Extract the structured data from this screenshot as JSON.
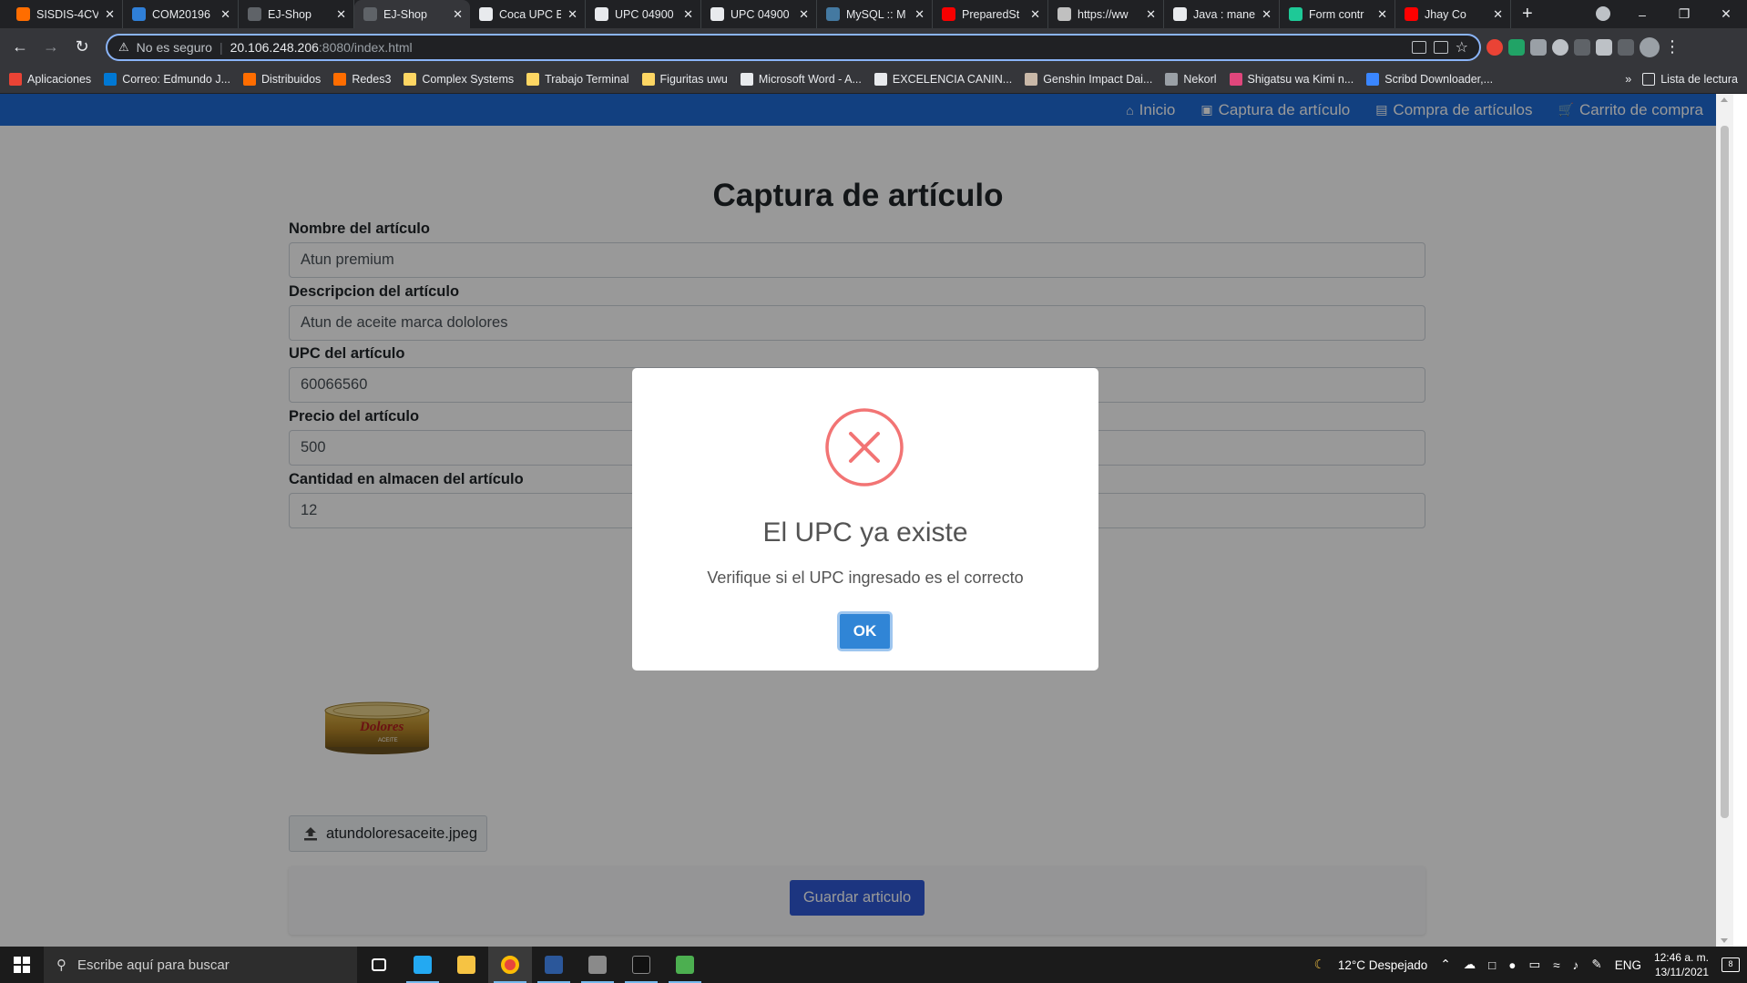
{
  "browser": {
    "tabs": [
      {
        "title": "SISDIS-4CV",
        "icon": "in-logo-icon",
        "color": "#ff6d00"
      },
      {
        "title": "COM20196",
        "icon": "azure-icon",
        "color": "#2f7fd8"
      },
      {
        "title": "EJ-Shop",
        "icon": "globe-icon",
        "color": "#5f6368"
      },
      {
        "title": "EJ-Shop",
        "icon": "globe-icon",
        "color": "#5f6368",
        "active": true
      },
      {
        "title": "Coca UPC B",
        "icon": "barcode-icon",
        "color": "#e8eaed"
      },
      {
        "title": "UPC 04900",
        "icon": "barcode-icon",
        "color": "#e8eaed"
      },
      {
        "title": "UPC 04900",
        "icon": "barcode-icon",
        "color": "#e8eaed"
      },
      {
        "title": "MySQL :: M",
        "icon": "mysql-icon",
        "color": "#4479a1"
      },
      {
        "title": "PreparedSt",
        "icon": "oracle-icon",
        "color": "#f80000"
      },
      {
        "title": "https://ww",
        "icon": "site-icon",
        "color": "#c0c0c0"
      },
      {
        "title": "Java : mane",
        "icon": "doc-icon",
        "color": "#e8eaed"
      },
      {
        "title": "Form contr",
        "icon": "leaf-icon",
        "color": "#1ec997"
      },
      {
        "title": "Jhay Co",
        "icon": "youtube-icon",
        "color": "#ff0000"
      }
    ],
    "security_label": "No es seguro",
    "url_host": "20.106.248.206",
    "url_rest": ":8080/index.html"
  },
  "bookmarks": [
    {
      "label": "Aplicaciones",
      "color": "#ea4335"
    },
    {
      "label": "Correo: Edmundo J...",
      "color": "#0078d4"
    },
    {
      "label": "Distribuidos",
      "color": "#ff6d00"
    },
    {
      "label": "Redes3",
      "color": "#ff6d00"
    },
    {
      "label": "Complex Systems",
      "color": "#fdd663"
    },
    {
      "label": "Trabajo Terminal",
      "color": "#fdd663"
    },
    {
      "label": "Figuritas uwu",
      "color": "#fdd663"
    },
    {
      "label": "Microsoft Word - A...",
      "color": "#e8eaed"
    },
    {
      "label": "EXCELENCIA CANIN...",
      "color": "#e8eaed"
    },
    {
      "label": "Genshin Impact Dai...",
      "color": "#c9b8a8"
    },
    {
      "label": "Nekorl",
      "color": "#9aa0a6"
    },
    {
      "label": "Shigatsu wa Kimi n...",
      "color": "#e0467c"
    },
    {
      "label": "Scribd Downloader,...",
      "color": "#3a86ff"
    }
  ],
  "bookmarks_more": "»",
  "reading_list": "Lista de lectura",
  "navbar": {
    "links": [
      {
        "label": "Inicio",
        "icon": "home-icon"
      },
      {
        "label": "Captura de artículo",
        "icon": "save-icon"
      },
      {
        "label": "Compra de artículos",
        "icon": "shopping-bag-icon"
      },
      {
        "label": "Carrito de compra",
        "icon": "cart-icon"
      }
    ]
  },
  "form": {
    "title": "Captura de artículo",
    "fields": [
      {
        "label": "Nombre del artículo",
        "value": "Atun premium"
      },
      {
        "label": "Descripcion del artículo",
        "value": "Atun de aceite marca dololores"
      },
      {
        "label": "UPC del artículo",
        "value": "60066560"
      },
      {
        "label": "Precio del artículo",
        "value": "500"
      },
      {
        "label": "Cantidad en almacen del artículo",
        "value": "12"
      }
    ],
    "image_brand": "Dolores",
    "image_caption": "ACEITE",
    "file_name": "atundoloresaceite.jpeg",
    "save_label": "Guardar articulo"
  },
  "modal": {
    "title": "El UPC ya existe",
    "text": "Verifique si el UPC ingresado es el correcto",
    "ok_label": "OK",
    "icon": "error-x-icon",
    "icon_color": "#f27474",
    "button_color": "#3085d6"
  },
  "taskbar": {
    "search_placeholder": "Escribe aquí para buscar",
    "weather": "12°C  Despejado",
    "language": "ENG",
    "time": "12:46 a. m.",
    "date": "13/11/2021",
    "notifications": "8"
  }
}
